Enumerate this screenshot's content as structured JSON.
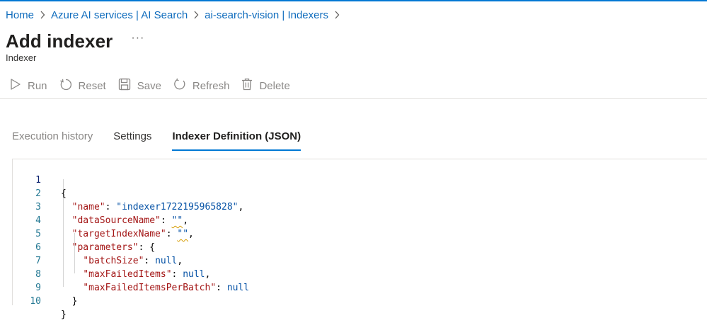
{
  "breadcrumb": {
    "items": [
      {
        "label": "Home"
      },
      {
        "label": "Azure AI services | AI Search"
      },
      {
        "label": "ai-search-vision | Indexers"
      }
    ]
  },
  "header": {
    "title": "Add indexer",
    "more_label": "···",
    "subtitle": "Indexer"
  },
  "toolbar": {
    "run_label": "Run",
    "reset_label": "Reset",
    "save_label": "Save",
    "refresh_label": "Refresh",
    "delete_label": "Delete"
  },
  "tabs": [
    {
      "label": "Execution history"
    },
    {
      "label": "Settings"
    },
    {
      "label": "Indexer Definition (JSON)"
    }
  ],
  "editor": {
    "lines": [
      {
        "num": "1"
      },
      {
        "num": "2",
        "key": "\"name\"",
        "val": "\"indexer1722195965828\""
      },
      {
        "num": "3",
        "key": "\"dataSourceName\"",
        "val": "\"\""
      },
      {
        "num": "4",
        "key": "\"targetIndexName\"",
        "val": "\"\""
      },
      {
        "num": "5",
        "key": "\"parameters\""
      },
      {
        "num": "6",
        "key": "\"batchSize\"",
        "val": "null"
      },
      {
        "num": "7",
        "key": "\"maxFailedItems\"",
        "val": "null"
      },
      {
        "num": "8",
        "key": "\"maxFailedItemsPerBatch\"",
        "val": "null"
      },
      {
        "num": "9"
      },
      {
        "num": "10"
      }
    ]
  }
}
